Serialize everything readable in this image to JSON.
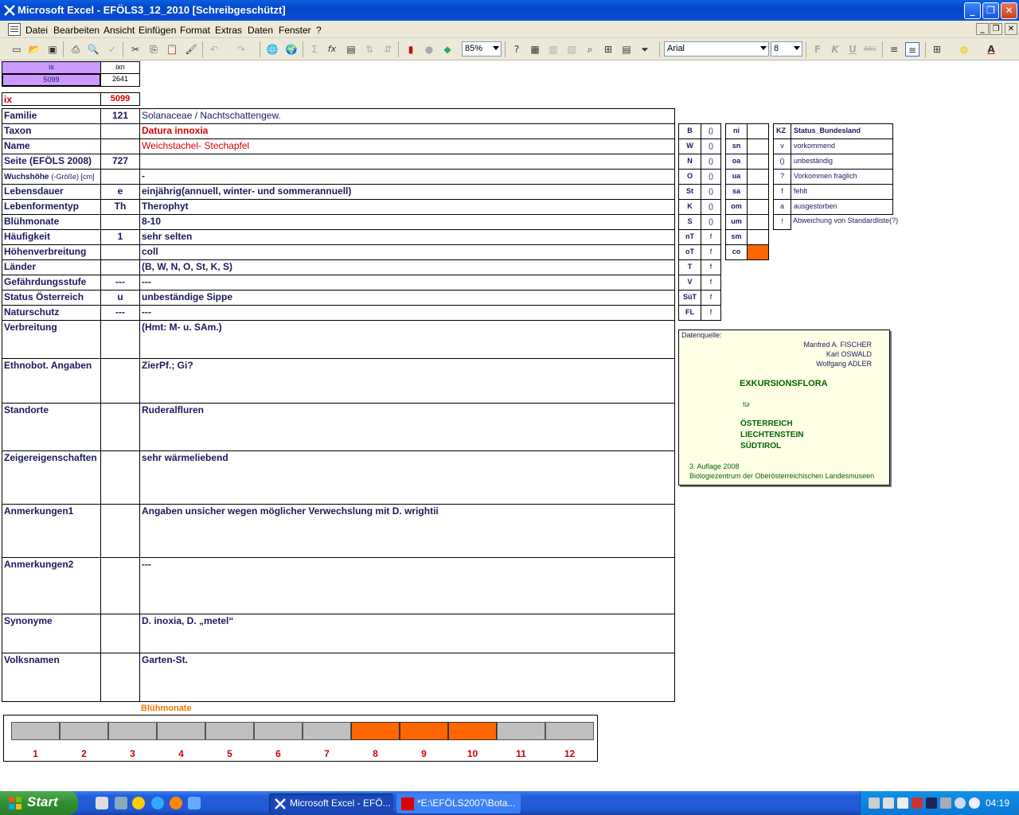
{
  "window": {
    "title": "Microsoft Excel - EFÖLS3_12_2010  [Schreibgeschützt]",
    "minimize_glyph": "_",
    "restore_glyph": "❐",
    "close_glyph": "✕"
  },
  "menu": {
    "items": [
      "Datei",
      "Bearbeiten",
      "Ansicht",
      "Einfügen",
      "Format",
      "Extras",
      "Daten",
      "Fenster",
      "?"
    ]
  },
  "toolbar": {
    "zoom": "85%",
    "font_name": "Arial",
    "font_size": "8",
    "bold": "F",
    "italic": "K",
    "underline": "U",
    "strike": "ABC",
    "autosum": "Σ",
    "function": "fx",
    "icons": [
      "new-icon",
      "open-icon",
      "save-icon",
      "print-icon",
      "print-preview-icon",
      "spellcheck-icon",
      "cut-icon",
      "copy-icon",
      "paste-icon",
      "format-painter-icon",
      "undo-icon",
      "redo-icon",
      "hyperlink-icon",
      "web-icon",
      "autosum-icon",
      "function-icon",
      "sort-asc-icon",
      "sort-desc-icon",
      "chart-icon",
      "map-icon",
      "drawing-icon",
      "help-icon",
      "filter-icon"
    ]
  },
  "index": {
    "ix_header": "ix",
    "ixn_header": "ixn",
    "ix_value": "5099",
    "ixn_value": "2641",
    "ix_label": "ix",
    "ix_big_value": "5099"
  },
  "fields": [
    {
      "label": "Familie",
      "code": "121",
      "value": "Solanaceae  /  Nachtschattengew."
    },
    {
      "label": "Taxon",
      "code": "",
      "value": "Datura innoxia"
    },
    {
      "label": "Name",
      "code": "",
      "value": "Weichstachel- Stechapfel"
    },
    {
      "label": "Seite (EFÖLS 2008)",
      "code": "727",
      "value": ""
    },
    {
      "label": "Wuchshöhe",
      "label_suffix": "(-Größe) [cm]",
      "code": "",
      "value": "  -"
    },
    {
      "label": "Lebensdauer",
      "code": "e",
      "value": "einjährig(annuell, winter- und sommerannuell)"
    },
    {
      "label": "Lebenformentyp",
      "code": "Th",
      "value": "Therophyt"
    },
    {
      "label": "Blühmonate",
      "code": "",
      "value": " 8-10"
    },
    {
      "label": "Häufigkeit",
      "code": "1",
      "value": "sehr selten"
    },
    {
      "label": "Höhenverbreitung",
      "code": "",
      "value": "coll"
    },
    {
      "label": "Länder",
      "code": "",
      "value": "(B, W, N, O, St, K, S)"
    },
    {
      "label": "Gefährdungsstufe",
      "code": "---",
      "value": "   ---"
    },
    {
      "label": "Status Österreich",
      "code": "u",
      "value": "unbeständige Sippe"
    },
    {
      "label": "Naturschutz",
      "code": "---",
      "value": "---"
    },
    {
      "label": "Verbreitung",
      "code": "",
      "value": "(Hmt: M- u. SAm.)"
    },
    {
      "label": "Ethnobot. Angaben",
      "code": "",
      "value": "ZierPf.;   Gi?"
    },
    {
      "label": "Standorte",
      "code": "",
      "value": "Ruderalfluren"
    },
    {
      "label": "Zeigereigenschaften",
      "code": "",
      "value": "sehr wärmeliebend"
    },
    {
      "label": "Anmerkungen1",
      "code": "",
      "value": "Angaben unsicher wegen möglicher Verwechslung mit D. wrightii"
    },
    {
      "label": "Anmerkungen2",
      "code": "",
      "value": "---"
    },
    {
      "label": "Synonyme",
      "code": "",
      "value": "D. inoxia, D. „metel“"
    },
    {
      "label": "Volksnamen",
      "code": "",
      "value": "Garten-St."
    }
  ],
  "regions1": [
    {
      "code": "B",
      "status": "()"
    },
    {
      "code": "W",
      "status": "()"
    },
    {
      "code": "N",
      "status": "()"
    },
    {
      "code": "O",
      "status": "()"
    },
    {
      "code": "St",
      "status": "()"
    },
    {
      "code": "K",
      "status": "()"
    },
    {
      "code": "S",
      "status": "()"
    },
    {
      "code": "nT",
      "status": "f"
    },
    {
      "code": "oT",
      "status": "f"
    },
    {
      "code": "T",
      "status": "f"
    },
    {
      "code": "V",
      "status": "f"
    },
    {
      "code": "SüT",
      "status": "f"
    },
    {
      "code": "FL",
      "status": "f"
    }
  ],
  "regions2": [
    {
      "code": "ni",
      "status": ""
    },
    {
      "code": "sn",
      "status": ""
    },
    {
      "code": "oa",
      "status": ""
    },
    {
      "code": "ua",
      "status": ""
    },
    {
      "code": "sa",
      "status": ""
    },
    {
      "code": "om",
      "status": ""
    },
    {
      "code": "um",
      "status": ""
    },
    {
      "code": "sm",
      "status": ""
    },
    {
      "code": "co",
      "status": "",
      "highlight": true
    }
  ],
  "legend": {
    "header_kz": "KZ",
    "header_status": "Status_Bundesland",
    "rows": [
      {
        "kz": "v",
        "text": "vorkommend"
      },
      {
        "kz": "()",
        "text": "unbeständig"
      },
      {
        "kz": "?",
        "text": "Vorkommen fraglich"
      },
      {
        "kz": "f",
        "text": "fehlt"
      },
      {
        "kz": "a",
        "text": "ausgestorben"
      },
      {
        "kz": "!",
        "text": "Abweichung von Standardliste(?)"
      }
    ]
  },
  "source": {
    "label": "Datenquelle:",
    "author1": "Manfred A. FISCHER",
    "author2": "Karl OSWALD",
    "author3": "Wolfgang ADLER",
    "book": "EXKURSIONSFLORA",
    "fuer": "für",
    "country1": "ÖSTERREICH",
    "country2": "LIECHTENSTEIN",
    "country3": "SÜDTIROL",
    "edition": "3. Auflage 2008",
    "publisher": "Biologiezentrum der Oberösterreichischen Landesmuseen"
  },
  "bloom": {
    "title": "Blühmonate",
    "months": [
      "1",
      "2",
      "3",
      "4",
      "5",
      "6",
      "7",
      "8",
      "9",
      "10",
      "11",
      "12"
    ],
    "active": [
      8,
      9,
      10
    ]
  },
  "taskbar": {
    "start": "Start",
    "tasks": [
      "Microsoft Excel - EFÖ...",
      "*E:\\EFÖLS2007\\Bota..."
    ],
    "clock": "04:19"
  },
  "colors": {
    "highlight_orange": "#ff6600",
    "index_purple": "#cc99ff",
    "label_navy": "#1a1a5e",
    "accent_red": "#d40000",
    "source_green": "#006600"
  }
}
